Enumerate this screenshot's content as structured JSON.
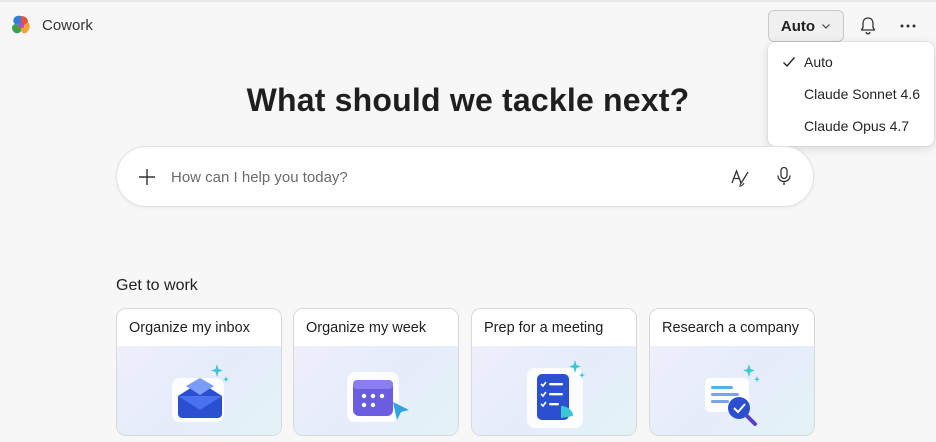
{
  "app": {
    "name": "Cowork"
  },
  "header": {
    "model_button_label": "Auto",
    "icons": [
      "bell-icon",
      "more-icon"
    ]
  },
  "model_menu": {
    "selected": "Auto",
    "items": [
      {
        "label": "Auto",
        "checked": true
      },
      {
        "label": "Claude Sonnet 4.6",
        "checked": false
      },
      {
        "label": "Claude Opus 4.7",
        "checked": false
      }
    ]
  },
  "hero": {
    "title": "What should we tackle next?"
  },
  "prompt": {
    "placeholder": "How can I help you today?",
    "value": ""
  },
  "section": {
    "title": "Get to work",
    "cards": [
      {
        "title": "Organize my inbox",
        "icon": "envelope-icon"
      },
      {
        "title": "Organize my week",
        "icon": "calendar-icon"
      },
      {
        "title": "Prep for a meeting",
        "icon": "checklist-icon"
      },
      {
        "title": "Research a company",
        "icon": "magnifier-icon"
      }
    ]
  },
  "colors": {
    "accent_blue": "#3b5bdb",
    "accent_cyan": "#22b8cf",
    "background": "#f7f7f7"
  }
}
